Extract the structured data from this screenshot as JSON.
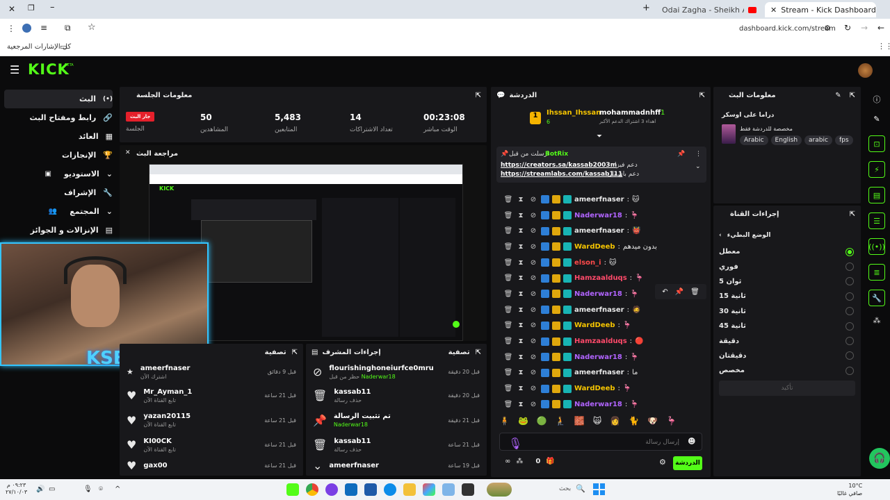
{
  "browser": {
    "tabs": [
      {
        "label": "Odai Zagha - Sheikh Al Arab (C"
      },
      {
        "label": "Stream - Kick Dashboard"
      }
    ],
    "url": "dashboard.kick.com/stream",
    "bookmarks_label": "كل الإشارات المرجعية"
  },
  "app": {
    "logo": "KICK",
    "logo_badge": "BETA"
  },
  "sidebar": {
    "items": [
      {
        "label": "البث",
        "icon": "live-icon"
      },
      {
        "label": "رابط ومفتاح البث",
        "icon": "link-icon"
      },
      {
        "label": "العائد",
        "icon": "revenue-icon"
      },
      {
        "label": "الإنجازات",
        "icon": "trophy-icon"
      },
      {
        "label": "الاستوديو",
        "icon": "studio-icon"
      },
      {
        "label": "الإشراف",
        "icon": "wrench-icon"
      },
      {
        "label": "المجتمع",
        "icon": "community-icon"
      },
      {
        "label": "الإنزالات و الجوائز",
        "icon": "drops-icon"
      }
    ]
  },
  "session": {
    "title": "معلومات الجلسة",
    "live_badge": "جار البث",
    "live_label": "الجلسة",
    "stats": [
      {
        "value": "50",
        "label": "المشاهدين"
      },
      {
        "value": "5,483",
        "label": "المتابعين"
      },
      {
        "value": "14",
        "label": "تعداد الاشتراكات"
      },
      {
        "value": "00:23:08",
        "label": "الوقت مباشر"
      }
    ]
  },
  "preview": {
    "title": "مراجعة البث"
  },
  "chat": {
    "title": "الدردشة",
    "gifters": [
      {
        "rank": "1",
        "name": "Ihssan_Ihssan",
        "count": "6"
      },
      {
        "rank": "1",
        "name": "mohammadnhff",
        "sub": "اهداء 3 اشتراك الدعم الأكبر"
      }
    ],
    "pinned": {
      "author": "BotRix",
      "header": "ارسلت من قبل",
      "line1": "https://creators.sa/kassab2003m",
      "line1_suffix": "دعم فيزا",
      "line2": "https://streamlabs.com/kassab111",
      "line2_suffix": "دعم باي بال"
    },
    "messages": [
      {
        "user": "ameerfnaser",
        "color": "#e8e8e8",
        "text": "🐱"
      },
      {
        "user": "Naderwar18",
        "color": "#b164ff",
        "text": "🦩"
      },
      {
        "user": "ameerfnaser",
        "color": "#e8e8e8",
        "text": "👹"
      },
      {
        "user": "WardDeeb",
        "color": "#f5c400",
        "text": "بدون ميدهم"
      },
      {
        "user": "elson_i",
        "color": "#ff4a4a",
        "text": "🐱"
      },
      {
        "user": "Hamzaalduqs",
        "color": "#ff4a6a",
        "text": "🦩"
      },
      {
        "user": "Naderwar18",
        "color": "#b164ff",
        "text": "🦩"
      },
      {
        "user": "ameerfnaser",
        "color": "#e8e8e8",
        "text": "🧔"
      },
      {
        "user": "WardDeeb",
        "color": "#f5c400",
        "text": "🦩"
      },
      {
        "user": "Hamzaalduqs",
        "color": "#ff4a6a",
        "text": "🔴"
      },
      {
        "user": "Naderwar18",
        "color": "#b164ff",
        "text": "🦩"
      },
      {
        "user": "ameerfnaser",
        "color": "#e8e8e8",
        "text": "ما"
      },
      {
        "user": "WardDeeb",
        "color": "#f5c400",
        "text": "🦩"
      },
      {
        "user": "Naderwar18",
        "color": "#b164ff",
        "text": "🦩"
      }
    ],
    "input_placeholder": "إرسال رسالة",
    "send_label": "الدردشة",
    "points": "0"
  },
  "stream_info": {
    "title": "معلومات البث",
    "stream_title": "دراما على اوسكر",
    "category": "مخصصة للدردشة فقط",
    "tags": [
      "Arabic",
      "English",
      "arabic",
      "fps"
    ]
  },
  "channel_actions": {
    "title": "إجراءات القناة",
    "slow_mode_title": "الوضع البطيء",
    "options": [
      "معطل",
      "فوري",
      "ثوان 5",
      "15 ثانية",
      "30 ثانية",
      "45 ثانية",
      "دقيقة",
      "دقيقتان",
      "مخصص"
    ],
    "selected_index": 0,
    "confirm_label": "تأكيد"
  },
  "activity": {
    "title": "تصفية",
    "items": [
      {
        "name": "ameerfnaser",
        "sub": "اشترك الآن",
        "time": "قبل 9 دقائق",
        "icon": "star-icon"
      },
      {
        "name": "Mr_Ayman_1",
        "sub": "تابع القناة الآن",
        "time": "قبل 21 ساعة",
        "icon": "heart-icon"
      },
      {
        "name": "yazan20115",
        "sub": "تابع القناة الآن",
        "time": "قبل 21 ساعة",
        "icon": "heart-icon"
      },
      {
        "name": "KI00CK",
        "sub": "تابع القناة الآن",
        "time": "قبل 21 ساعة",
        "icon": "heart-icon"
      },
      {
        "name": "gax00",
        "sub": "",
        "time": "قبل 21 ساعة",
        "icon": "heart-icon"
      }
    ]
  },
  "mod_actions": {
    "title": "إجراءات المشرف",
    "filter_label": "تصفية",
    "items": [
      {
        "name": "flourishinghoneiurfce0mru",
        "sub": "حظر من قبل",
        "by": "Naderwar18",
        "time": "قبل 20 دقيقة",
        "icon": "ban-icon"
      },
      {
        "name": "kassab11",
        "sub": "حذف رسالة",
        "by": "",
        "time": "قبل 20 دقيقة",
        "icon": "trash-icon"
      },
      {
        "name": "تم تثبيت الرسالة",
        "sub": "",
        "by": "Naderwar18",
        "time": "قبل 21 دقيقة",
        "icon": "pin-icon"
      },
      {
        "name": "kassab11",
        "sub": "حذف رسالة",
        "by": "",
        "time": "قبل 21 ساعة",
        "icon": "trash-icon"
      },
      {
        "name": "ameerfnaser",
        "sub": "",
        "by": "",
        "time": "قبل 19 ساعة",
        "icon": "chevron-down-icon"
      }
    ]
  },
  "taskbar": {
    "search_placeholder": "بحث",
    "weather": "10°C",
    "weather_sub": "صافي غالبًا",
    "time": "٠٩:٢٣ م",
    "date": "٢٧/١٠/٠٣"
  },
  "colors": {
    "accent": "#53fc18",
    "panel": "#18181b",
    "bg": "#0b0b0c"
  }
}
